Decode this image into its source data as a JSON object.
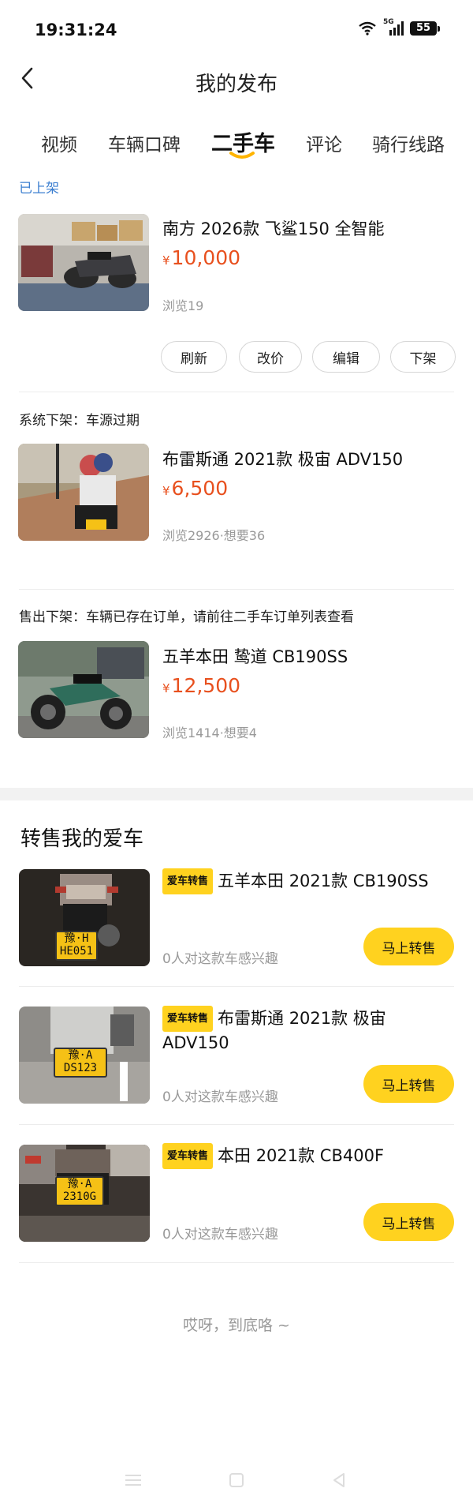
{
  "status_bar": {
    "time": "19:31:24",
    "network": "5G",
    "battery": "55"
  },
  "header": {
    "title": "我的发布"
  },
  "tabs": [
    {
      "label": "视频"
    },
    {
      "label": "车辆口碑"
    },
    {
      "label": "二手车"
    },
    {
      "label": "评论"
    },
    {
      "label": "骑行线路"
    }
  ],
  "sections": [
    {
      "status": "已上架",
      "listing": {
        "title": "南方 2026款 飞鲨150 全智能",
        "currency": "¥",
        "price": "10,000",
        "stats": "浏览19"
      },
      "actions": [
        "刷新",
        "改价",
        "编辑",
        "下架"
      ]
    },
    {
      "status": "系统下架：车源过期",
      "listing": {
        "title": "布雷斯通 2021款 极宙 ADV150",
        "currency": "¥",
        "price": "6,500",
        "stats": "浏览2926·想要36"
      }
    },
    {
      "status": "售出下架：车辆已存在订单，请前往二手车订单列表查看",
      "listing": {
        "title": "五羊本田 鸷道 CB190SS",
        "currency": "¥",
        "price": "12,500",
        "stats": "浏览1414·想要4"
      }
    }
  ],
  "resale": {
    "heading": "转售我的爱车",
    "items": [
      {
        "badge": "爱车转售",
        "title": "五羊本田 2021款 CB190SS",
        "interest": "0人对这款车感兴趣",
        "cta": "马上转售",
        "plate_top": "豫·H",
        "plate_bottom": "HE051"
      },
      {
        "badge": "爱车转售",
        "title": "布雷斯通 2021款 极宙 ADV150",
        "interest": "0人对这款车感兴趣",
        "cta": "马上转售",
        "plate_top": "豫·A",
        "plate_bottom": "DS123"
      },
      {
        "badge": "爱车转售",
        "title": "本田 2021款 CB400F",
        "interest": "0人对这款车感兴趣",
        "cta": "马上转售",
        "plate_top": "豫·A",
        "plate_bottom": "2310G"
      }
    ]
  },
  "footer": {
    "text": "哎呀，到底咯 ~"
  },
  "colors": {
    "accent_yellow": "#ffd21f",
    "price_orange": "#e8501e",
    "status_blue": "#3c7fd0"
  },
  "icons": {
    "back": "chevron-left-icon",
    "wifi": "wifi-icon",
    "signal": "signal-icon",
    "battery": "battery-icon"
  }
}
